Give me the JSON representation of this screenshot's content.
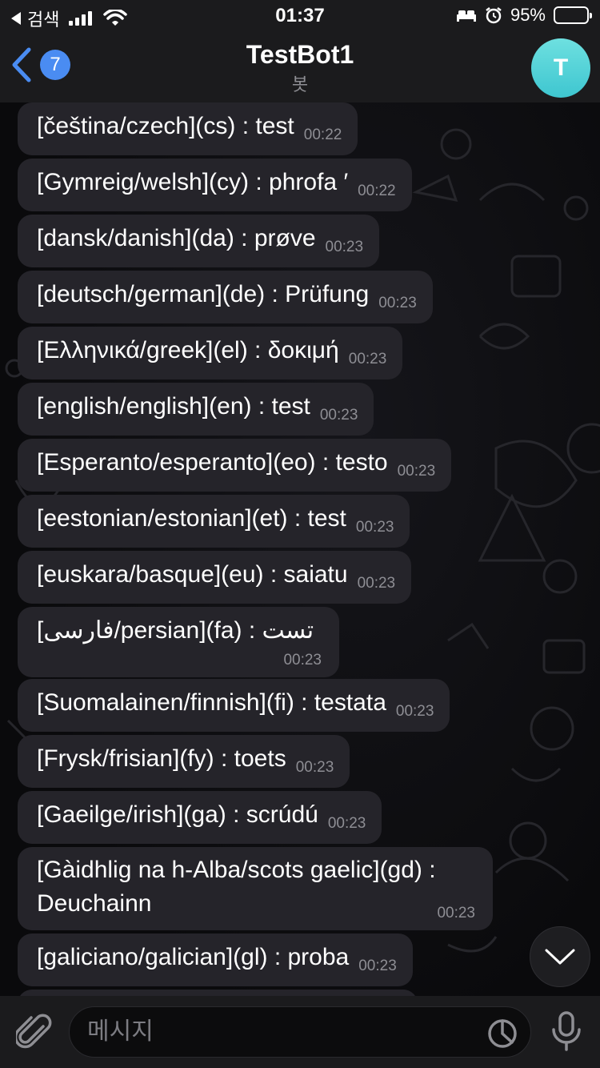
{
  "status_bar": {
    "carrier": "검색",
    "time": "01:37",
    "battery": "95%",
    "battery_level": 0.95
  },
  "header": {
    "unread_count": "7",
    "title": "TestBot1",
    "subtitle": "봇",
    "avatar_letter": "T"
  },
  "messages": [
    {
      "text": "[čeština/czech](cs) : test",
      "time": "00:22"
    },
    {
      "text": "[Gymreig/welsh](cy) : phrofa ′",
      "time": "00:22"
    },
    {
      "text": "[dansk/danish](da) : prøve",
      "time": "00:23"
    },
    {
      "text": "[deutsch/german](de) : Prüfung",
      "time": "00:23"
    },
    {
      "text": "[Ελληνικά/greek](el) : δοκιμή",
      "time": "00:23"
    },
    {
      "text": "[english/english](en) : test",
      "time": "00:23"
    },
    {
      "text": "[Esperanto/esperanto](eo) : testo",
      "time": "00:23"
    },
    {
      "text": "[eestonian/estonian](et) : test",
      "time": "00:23"
    },
    {
      "text": "[euskara/basque](eu) : saiatu",
      "time": "00:23"
    },
    {
      "text": "تست : (fa)[persian/فارسی]",
      "time": "00:23"
    },
    {
      "text": "[Suomalainen/finnish](fi) : testata",
      "time": "00:23"
    },
    {
      "text": "[Frysk/frisian](fy) : toets",
      "time": "00:23"
    },
    {
      "text": "[Gaeilge/irish](ga) : scrúdú",
      "time": "00:23"
    },
    {
      "text": "[Gàidhlig na h-Alba/scots gaelic](gd) : Deuchainn",
      "time": "00:23"
    },
    {
      "text": "[galiciano/galician](gl) : proba",
      "time": "00:23"
    }
  ],
  "input": {
    "placeholder": "메시지"
  }
}
